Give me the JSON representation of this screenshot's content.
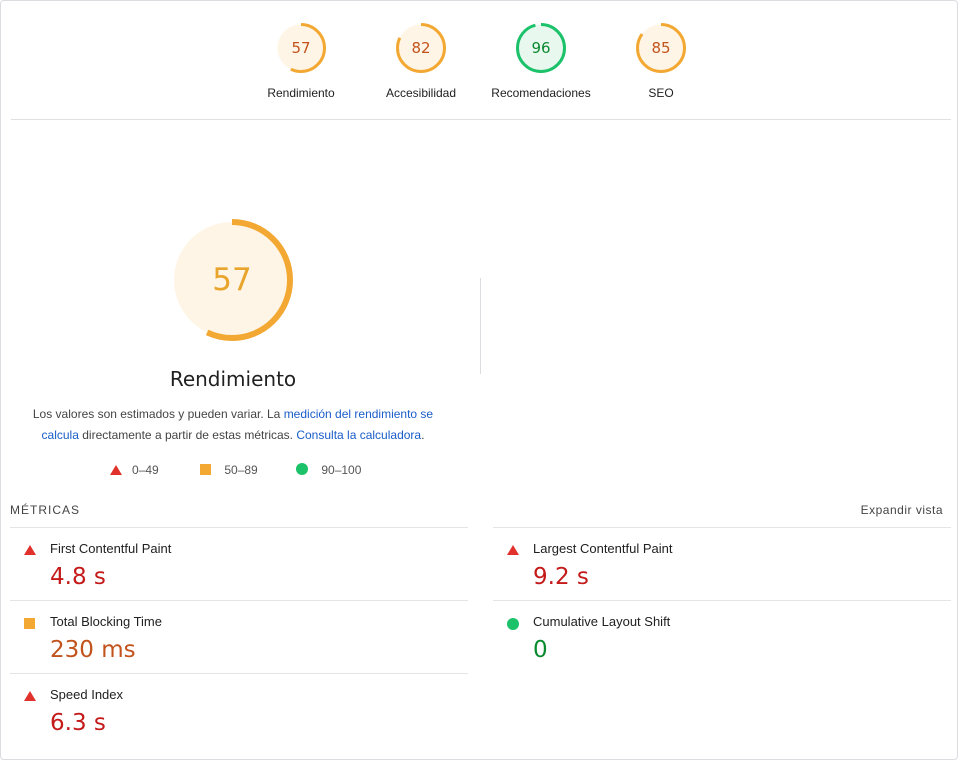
{
  "categories": [
    {
      "label": "Rendimiento",
      "score": "57",
      "fraction": 0.57,
      "color": "#f2a833",
      "fill": "#fff5e6",
      "text": "#c2531c"
    },
    {
      "label": "Accesibilidad",
      "score": "82",
      "fraction": 0.82,
      "color": "#f2a833",
      "fill": "#fff5e6",
      "text": "#c2531c"
    },
    {
      "label": "Recomendaciones",
      "score": "96",
      "fraction": 0.96,
      "color": "#1cc26a",
      "fill": "#e8f8ee",
      "text": "#0a8a2e"
    },
    {
      "label": "SEO",
      "score": "85",
      "fraction": 0.85,
      "color": "#f2a833",
      "fill": "#fff5e6",
      "text": "#c2531c"
    }
  ],
  "performance": {
    "score": "57",
    "fraction": 0.57,
    "title": "Rendimiento",
    "desc_part1": "Los valores son estimados y pueden variar. La ",
    "desc_link1": "medición del rendimiento se calcula",
    "desc_part2": " directamente a partir de estas métricas. ",
    "desc_link2": "Consulta la calculadora",
    "desc_part3": "."
  },
  "legend": [
    {
      "shape": "triangle-icon",
      "label": "0–49"
    },
    {
      "shape": "square-icon",
      "label": "50–89"
    },
    {
      "shape": "circle-icon",
      "label": "90–100"
    }
  ],
  "metrics": {
    "heading": "MÉTRICAS",
    "expand_label": "Expandir vista",
    "items": [
      {
        "name": "First Contentful Paint",
        "value": "4.8 s",
        "rating": "fail"
      },
      {
        "name": "Largest Contentful Paint",
        "value": "9.2 s",
        "rating": "fail"
      },
      {
        "name": "Total Blocking Time",
        "value": "230 ms",
        "rating": "average"
      },
      {
        "name": "Cumulative Layout Shift",
        "value": "0",
        "rating": "pass"
      },
      {
        "name": "Speed Index",
        "value": "6.3 s",
        "rating": "fail"
      }
    ]
  }
}
